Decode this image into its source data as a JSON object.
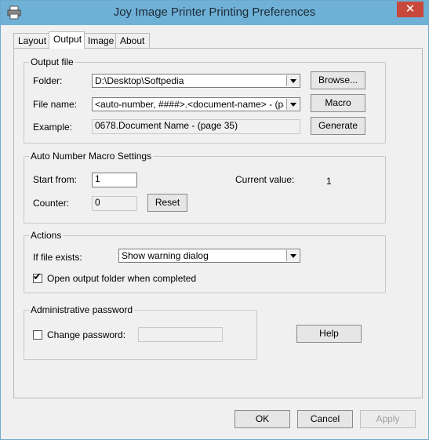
{
  "window": {
    "title": "Joy Image Printer Printing Preferences",
    "close": "✕"
  },
  "tabs": [
    {
      "label": "Layout"
    },
    {
      "label": "Output"
    },
    {
      "label": "Image"
    },
    {
      "label": "About"
    }
  ],
  "output_file": {
    "legend": "Output file",
    "folder_label": "Folder:",
    "folder_value": "D:\\Desktop\\Softpedia",
    "browse": "Browse...",
    "filename_label": "File name:",
    "filename_value": "<auto-number, ####>.<document-name> - (page <page",
    "macro": "Macro",
    "example_label": "Example:",
    "example_value": "0678.Document Name - (page 35)",
    "generate": "Generate"
  },
  "auto_number": {
    "legend": "Auto Number Macro Settings",
    "start_label": "Start from:",
    "start_value": "1",
    "current_label": "Current value:",
    "current_value": "1",
    "counter_label": "Counter:",
    "counter_value": "0",
    "reset": "Reset"
  },
  "actions": {
    "legend": "Actions",
    "exists_label": "If file exists:",
    "exists_value": "Show warning dialog",
    "open_label": "Open output folder when completed",
    "open_checked": true
  },
  "admin": {
    "legend": "Administrative password",
    "change_label": "Change password:",
    "change_checked": false
  },
  "help": "Help",
  "footer": {
    "ok": "OK",
    "cancel": "Cancel",
    "apply": "Apply"
  }
}
